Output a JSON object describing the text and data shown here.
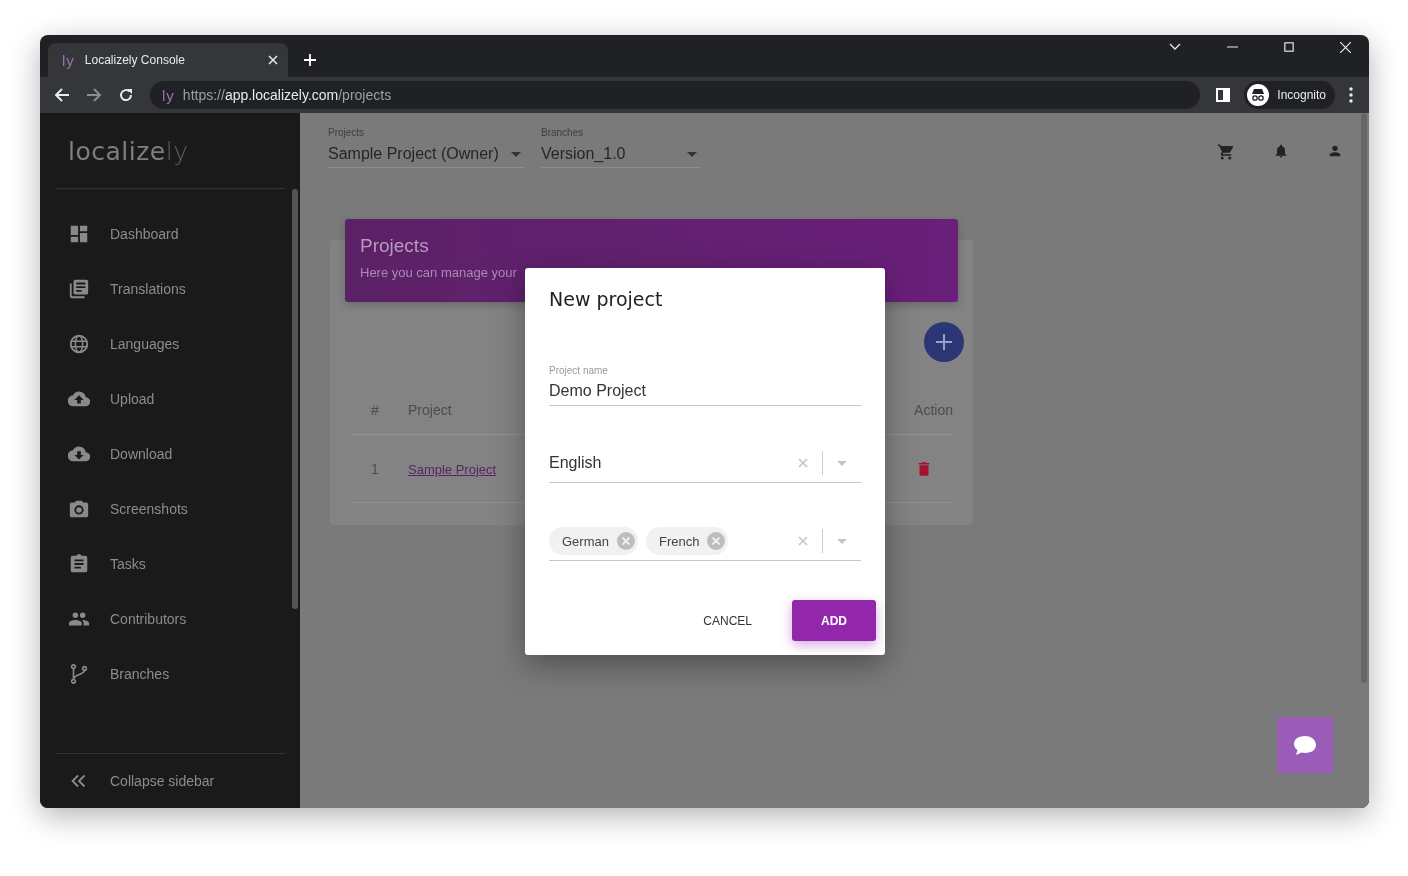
{
  "browser": {
    "tab_icon": "ly",
    "tab_title": "Localizely Console",
    "site_icon": "ly",
    "url": {
      "scheme": "https://",
      "host": "app.localizely.com",
      "path": "/projects"
    },
    "profile": "Incognito"
  },
  "sidebar": {
    "logo": {
      "main": "localize",
      "accent": "ly"
    },
    "items": [
      {
        "label": "Dashboard",
        "kind": "dashboard"
      },
      {
        "label": "Translations",
        "kind": "translations"
      },
      {
        "label": "Languages",
        "kind": "globe"
      },
      {
        "label": "Upload",
        "kind": "upload"
      },
      {
        "label": "Download",
        "kind": "download"
      },
      {
        "label": "Screenshots",
        "kind": "camera"
      },
      {
        "label": "Tasks",
        "kind": "clipboard"
      },
      {
        "label": "Contributors",
        "kind": "people"
      },
      {
        "label": "Branches",
        "kind": "branch"
      }
    ],
    "collapse": "Collapse sidebar"
  },
  "topbar": {
    "selects": [
      {
        "label": "Projects",
        "value": "Sample Project (Owner)"
      },
      {
        "label": "Branches",
        "value": "Version_1.0"
      }
    ]
  },
  "card": {
    "title": "Projects",
    "subtitle": "Here you can manage your",
    "columns": [
      "#",
      "Project",
      "Action"
    ],
    "rows": [
      {
        "number": "1",
        "project": "Sample Project"
      }
    ]
  },
  "dialog": {
    "title": "New project",
    "name_field": {
      "label": "Project name",
      "value": "Demo Project"
    },
    "source_language": {
      "value": "English"
    },
    "target_languages": {
      "chips": [
        "German",
        "French"
      ]
    },
    "buttons": {
      "cancel": "CANCEL",
      "add": "ADD"
    }
  }
}
